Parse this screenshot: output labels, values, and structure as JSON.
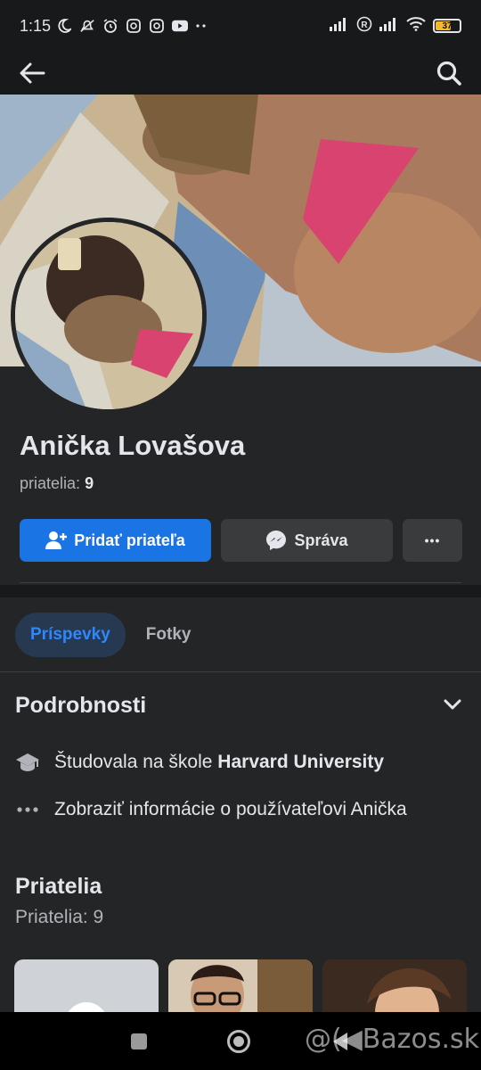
{
  "status_bar": {
    "time": "1:15",
    "battery": "37",
    "icons": [
      "moon-icon",
      "mute-icon",
      "alarm-icon",
      "instagram-icon",
      "instagram-icon",
      "youtube-icon",
      "more-dots-icon",
      "signal-icon",
      "r-icon",
      "signal-icon",
      "wifi-icon",
      "battery-icon"
    ]
  },
  "profile": {
    "name": "Anička Lovašova",
    "friends_label": "priatelia:",
    "friends_value": "9"
  },
  "actions": {
    "add_friend": "Pridať priateľa",
    "message": "Správa",
    "more": "•••"
  },
  "tabs": {
    "posts": "Príspevky",
    "photos": "Fotky"
  },
  "details": {
    "title": "Podrobnosti",
    "education_prefix": "Študovala na škole ",
    "education_school": "Harvard University",
    "more_info": "Zobraziť informácie o používateľovi Anička"
  },
  "friends": {
    "title": "Priatelia",
    "subtitle": "Priatelia: 9"
  },
  "watermark": "@(◀Bazos.sk",
  "colors": {
    "background": "#242526",
    "primary": "#1b74e4",
    "secondary_button": "#3a3b3c",
    "active_tab_bg": "#263951",
    "active_tab_text": "#2d88ff"
  }
}
